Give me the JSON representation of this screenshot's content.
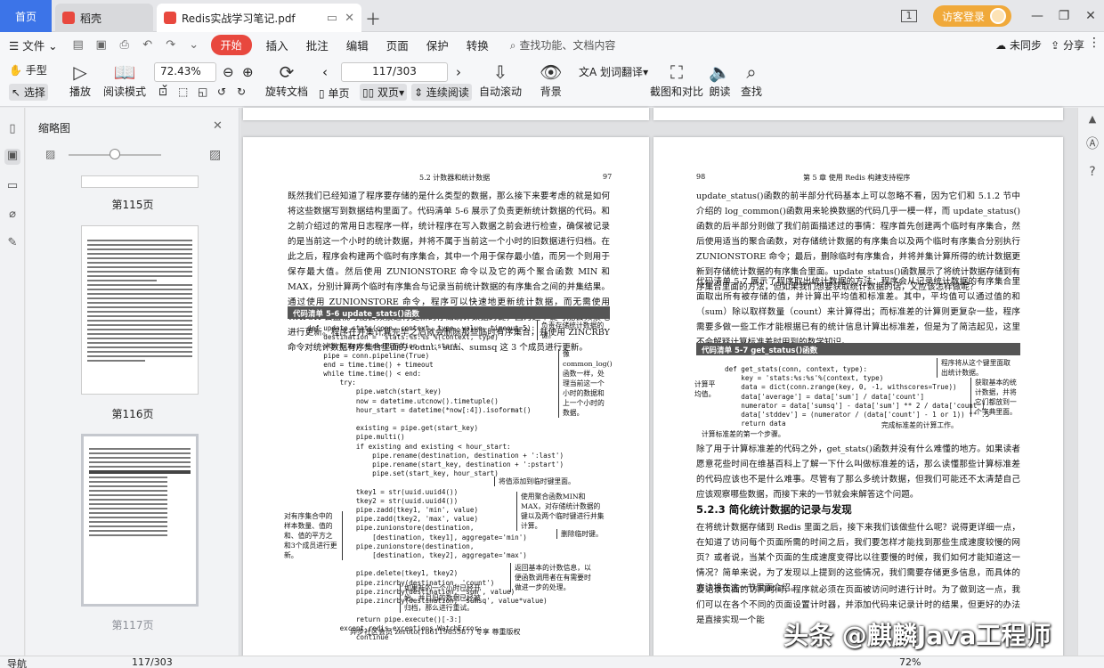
{
  "tabs": {
    "home": "首页",
    "daoke": "稻壳",
    "pdf": "Redis实战学习笔记.pdf"
  },
  "window": {
    "login": "访客登录",
    "page_count_badge": "1"
  },
  "menu": {
    "file": "文件",
    "start": "开始",
    "insert": "插入",
    "annotate": "批注",
    "edit": "编辑",
    "page": "页面",
    "protect": "保护",
    "convert": "转换",
    "search": "查找功能、文档内容",
    "sync": "未同步",
    "share": "分享"
  },
  "toolbar": {
    "hand": "手型",
    "select": "选择",
    "play": "播放",
    "read_mode": "阅读模式",
    "zoom": "72.43%",
    "page_indicator": "117/303",
    "rotate": "旋转文档",
    "single": "单页",
    "double": "双页",
    "continuous": "连续阅读",
    "autoscroll": "自动滚动",
    "background": "背景",
    "translate": "划词翻译",
    "screenshot": "截图和对比",
    "read_aloud": "朗读",
    "find": "查找"
  },
  "thumbnails": {
    "title": "缩略图",
    "labels": [
      "第115页",
      "第116页",
      "第117页"
    ]
  },
  "left_page": {
    "header_section": "5.2 计数器和统计数据",
    "header_num": "97",
    "para1": "既然我们已经知道了程序要存储的是什么类型的数据，那么接下来要考虑的就是如何将这些数据写到数据结构里面了。代码清单 5-6 展示了负责更新统计数据的代码。和之前介绍过的常用日志程序一样，统计程序在写入数据之前会进行检查，确保被记录的是当前这一个小时的统计数据，并将不属于当前这一个小时的旧数据进行归档。在此之后，程序会构建两个临时有序集合，其中一个用于保存最小值，而另一个则用于保存最大值。然后使用 ZUNIONSTORE 命令以及它的两个聚合函数 MIN 和 MAX，分别计算两个临时有序集合与记录当前统计数据的有序集合之间的并集结果。通过使用 ZUNIONSTORE 命令，程序可以快速地更新统计数据，而无需使用 WATCH 去监视可能会频繁进行更新的存储统计数据的键，因为这个键可能会频繁地进行更新。程序在并集计算完毕之后就会删除那些临时有序集合，并使用 ZINCRBY 命令对统计数据有序集合里面的 count、sum、sumsq 这 3 个成员进行更新。",
    "listing_title": "代码清单 5-6  update_stats()函数",
    "code": "def update_stats(conn, context, type, value, timeout=5):\n    destination = 'stats:%s:%s'%(context, type)\n    start_key = destination + ':start'\n    pipe = conn.pipeline(True)\n    end = time.time() + timeout\n    while time.time() < end:\n        try:\n            pipe.watch(start_key)\n            now = datetime.utcnow().timetuple()\n            hour_start = datetime(*now[:4]).isoformat()\n\n            existing = pipe.get(start_key)\n            pipe.multi()\n            if existing and existing < hour_start:\n                pipe.rename(destination, destination + ':last')\n                pipe.rename(start_key, destination + ':pstart')\n                pipe.set(start_key, hour_start)\n\n            tkey1 = str(uuid.uuid4())\n            tkey2 = str(uuid.uuid4())\n            pipe.zadd(tkey1, 'min', value)\n            pipe.zadd(tkey2, 'max', value)\n            pipe.zunionstore(destination,\n                [destination, tkey1], aggregate='min')\n            pipe.zunionstore(destination,\n                [destination, tkey2], aggregate='max')\n\n            pipe.delete(tkey1, tkey2)\n            pipe.zincrby(destination, 'count')\n            pipe.zincrby(destination, 'sum', value)\n            pipe.zincrby(destination, 'sumsq', value*value)\n\n            return pipe.execute()[-3:]\n        except redis.exceptions.WatchError:\n            continue",
    "notes": [
      "负责存储统计数据的键。",
      "像common_log()函数一样，处理当前这一个小时的数据和上一个小时的数据。",
      "将值添加到临时键里面。",
      "使用聚合函数MIN和MAX，对存储统计数据的键以及两个临时键进行并集计算。",
      "删除临时键。",
      "对有序集合中的样本数量、值的和、值的平方之和3个成员进行更新。",
      "返回基本的计数信息，以便函数调用者在有需要时做进一步的处理。",
      "如果新的一个小时已经开始，并且旧的数据已经被归档，那么进行重试。"
    ],
    "footer": "异步社区会员 zeroto(18611985587) 专享 尊重版权"
  },
  "right_page": {
    "header_num": "98",
    "header_section": "第 5 章  使用 Redis 构建支持程序",
    "para1": "update_status()函数的前半部分代码基本上可以忽略不看，因为它们和 5.1.2 节中介绍的 log_common()函数用来轮换数据的代码几乎一模一样，而 update_status()函数的后半部分则做了我们前面描述过的事情：程序首先创建两个临时有序集合，然后使用适当的聚合函数，对存储统计数据的有序集合以及两个临时有序集合分别执行 ZUNIONSTORE 命令；最后，删除临时有序集合，并将并集计算所得的统计数据更新到存储统计数据的有序集合里面。update_status()函数展示了将统计数据存储到有序集合里面的方法，但如果我们想要获取统计数据的话，又应该怎样做呢？",
    "para2": "代码清单 5-7 展示了程序取出统计数据的方法：程序会从记录统计数据的有序集合里面取出所有被存储的值，并计算出平均值和标准差。其中，平均值可以通过值的和（sum）除以取样数量（count）来计算得出；而标准差的计算则更复杂一些，程序需要多做一些工作才能根据已有的统计信息计算出标准差，但是为了简洁起见，这里不会解释计算标准差时用到的数学知识。",
    "listing_title": "代码清单 5-7  get_status()函数",
    "code": "def get_stats(conn, context, type):\n    key = 'stats:%s:%s'%(context, type)\n    data = dict(conn.zrange(key, 0, -1, withscores=True))\n    data['average'] = data['sum'] / data['count']\n    numerator = data['sumsq'] - data['sum'] ** 2 / data['count']\n    data['stddev'] = (numerator / (data['count'] - 1 or 1)) ** .5\n    return data",
    "notes": [
      "程序将从这个键里面取出统计数据。",
      "获取基本的统计数据，并将它们都放到一个字典里面。",
      "计算平均值。",
      "计算标准差的第一个步骤。",
      "完成标准差的计算工作。"
    ],
    "para3": "除了用于计算标准差的代码之外，get_stats()函数并没有什么难懂的地方。如果读者愿意花些时间在维基百科上了解一下什么叫做标准差的话，那么读懂那些计算标准差的代码应该也不是什么难事。尽管有了那么多统计数据，但我们可能还不太清楚自己应该观察哪些数据，而接下来的一节就会来解答这个问题。",
    "section": "5.2.3  简化统计数据的记录与发现",
    "para4": "在将统计数据存储到 Redis 里面之后，接下来我们该做些什么呢？说得更详细一点，在知道了访问每个页面所需的时间之后，我们要怎样才能找到那些生成速度较慢的网页？或者说，当某个页面的生成速度变得比以往要慢的时候，我们如何才能知道这一情况？简单来说，为了发现以上提到的这些情况，我们需要存储更多信息，而具体的方法将在这一节里面介绍。",
    "para5": "要记录页面的访问时间，程序就必须在页面被访问时进行计时。为了做到这一点，我们可以在各个不同的页面设置计时器，并添加代码来记录计时的结果，但更好的办法是直接实现一个能"
  },
  "status": {
    "nav": "导航",
    "page": "117/303",
    "zoom": "72%"
  },
  "watermark": "头条 @麒麟Java工程师"
}
